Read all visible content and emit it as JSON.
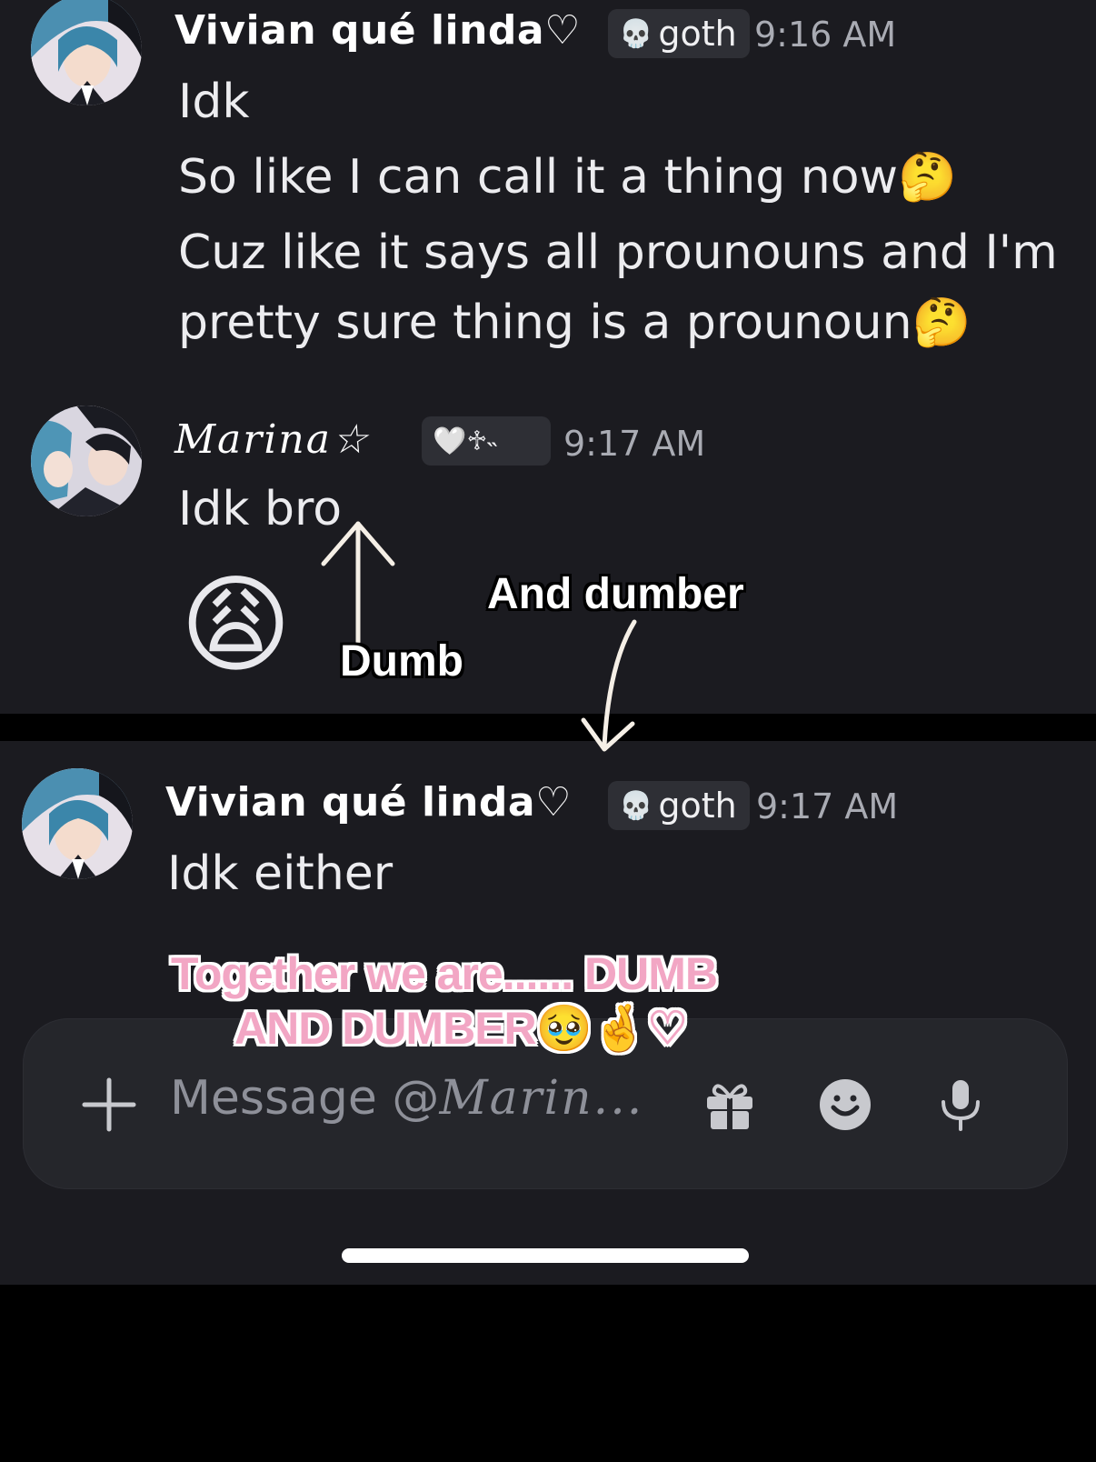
{
  "messages_top": [
    {
      "author": "Vivian qué linda♡",
      "tag": "goth",
      "tag_icon": "skull-icon",
      "time": "9:16 AM",
      "lines": [
        "Idk",
        "So like I can call it a thing now🤔",
        "Cuz like it says all prounouns and I'm",
        "pretty sure thing is a prounoun🤔"
      ]
    },
    {
      "author": "Marina☆",
      "tag": "🤍♱˵",
      "time": "9:17 AM",
      "lines": [
        "Idk bro"
      ],
      "big_emoji": "😩"
    }
  ],
  "annotations": {
    "dumb": "Dumb",
    "and_dumber": "And dumber",
    "together_line1": "Together we are...... DUMB",
    "together_line2": "AND DUMBER🥹🤞♡"
  },
  "messages_bottom": [
    {
      "author": "Vivian qué linda♡",
      "tag": "goth",
      "tag_icon": "skull-icon",
      "time": "9:17 AM",
      "lines": [
        "Idk either"
      ]
    }
  ],
  "composer": {
    "placeholder_prefix": "Message @",
    "placeholder_name": "Marin...",
    "buttons": [
      "plus-icon",
      "gift-icon",
      "emoji-icon",
      "microphone-icon"
    ]
  }
}
